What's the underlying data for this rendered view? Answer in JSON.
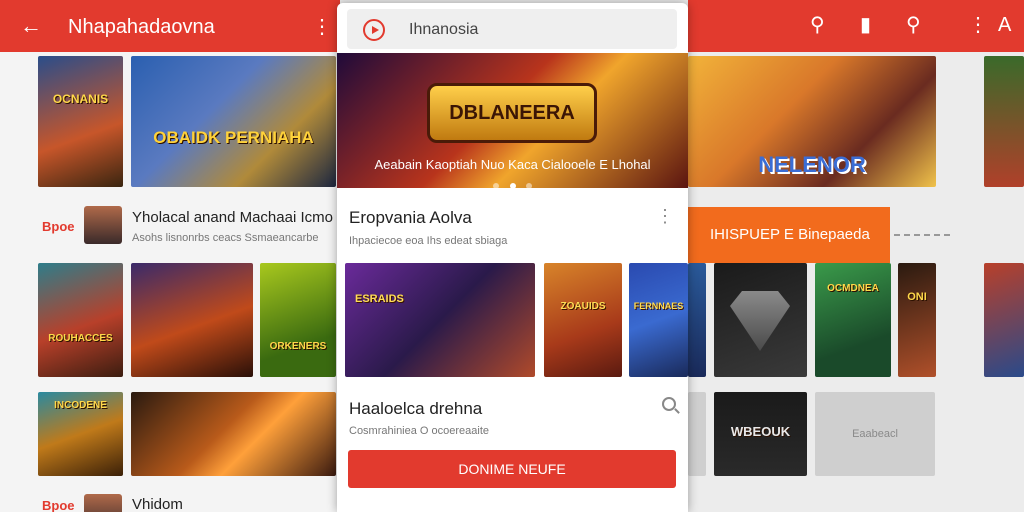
{
  "left_app": {
    "title": "Nhapahadaovna",
    "tiles": [
      {
        "label": "OCNANIS"
      },
      {
        "label": "OBAIDK PERNIAHA"
      }
    ],
    "row1": {
      "tag": "Bpoe",
      "title": "Yholacal anand Machaai Icmo",
      "subtitle": "Asohs lisnonrbs ceacs Ssmaeancarbe"
    },
    "grid_tiles": [
      {
        "label": "ROUHACCES"
      },
      {
        "label": ""
      },
      {
        "label": "ORKENERS"
      }
    ],
    "row2_tiles": [
      {
        "label": "INCODENE"
      },
      {
        "label": ""
      }
    ],
    "row3": {
      "tag": "Bpoe",
      "title": "Vhidom"
    }
  },
  "phone": {
    "search_text": "Ihnanosia",
    "banner": {
      "logo_text": "DBLANEERA",
      "caption": "Aeabain Kaoptiah Nuo Kaca Cialooele E Lhohal",
      "dots": 3,
      "active_dot": 1
    },
    "section1": {
      "title": "Eropvania Aolva",
      "subtitle": "Ihpaciecoe eoa Ihs edeat sbiaga",
      "more_icon": "more-vert-icon",
      "games": [
        {
          "label": "ESRAIDS"
        },
        {
          "label": "ZOAUIDS"
        },
        {
          "label": "FERNNAES"
        }
      ]
    },
    "section2": {
      "title": "Haaloelca drehna",
      "subtitle": "Cosmrahiniea O ocoereaaite",
      "search_icon": "search-icon"
    },
    "cta_label": "DONIME NEUFE"
  },
  "right_app": {
    "icons": [
      "search-icon",
      "bookmark-icon",
      "search-icon",
      "more-vert-icon",
      "text-icon"
    ],
    "banner_title": "NELENOR",
    "orange_banner": "IHISPUEP E Binepaeda",
    "grid_labels": [
      "",
      "",
      "OCMDNEA",
      "",
      "ONI"
    ],
    "row2_label": "WBEOUK",
    "grey_tile_label": "Eaabeacl"
  },
  "colors": {
    "brand_red": "#e23a2e",
    "accent_orange": "#f26b1d"
  }
}
